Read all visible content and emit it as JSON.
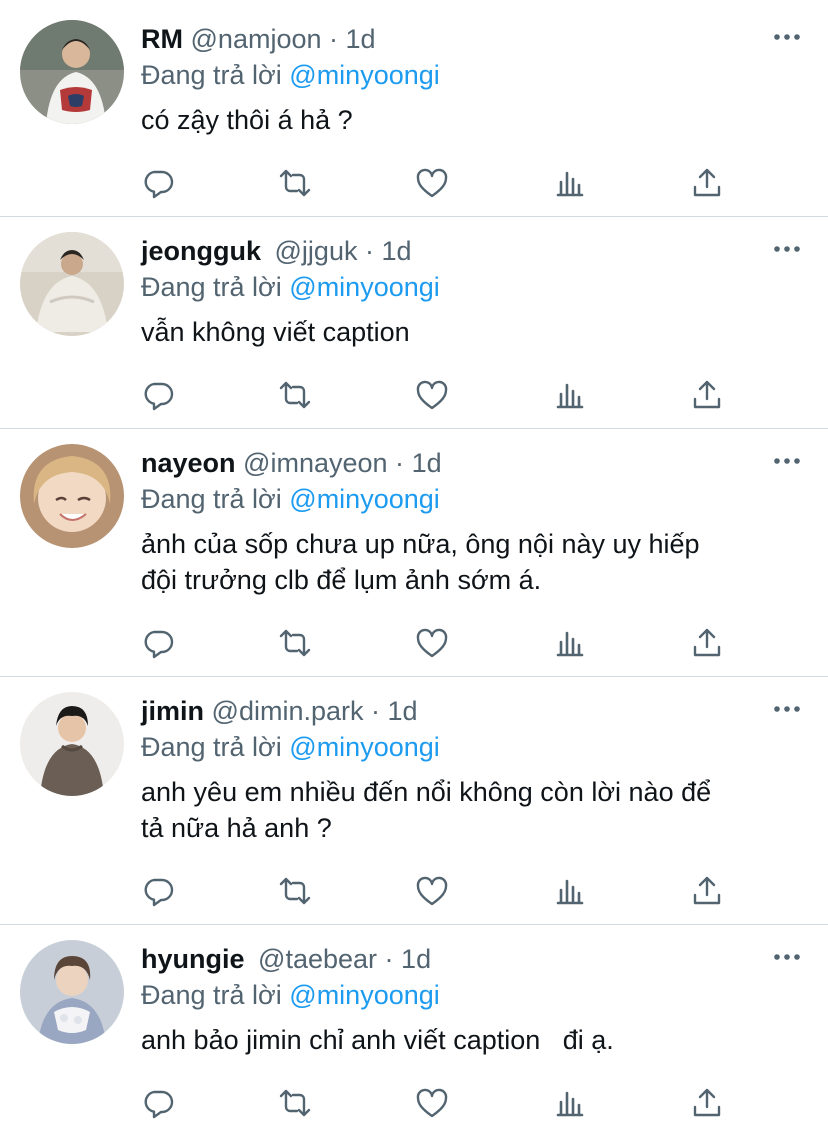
{
  "tweets": [
    {
      "name": "RM",
      "handle": "@namjoon",
      "sep": "·",
      "time": "1d",
      "reply_prefix": "Đang trả lời",
      "reply_to": "@minyoongi",
      "text": "có zậy thôi á hả ?",
      "avatar_bg": "#7c8a7a"
    },
    {
      "name": "jeongguk",
      "handle": "@jjguk",
      "sep": "·",
      "time": "1d",
      "reply_prefix": "Đang trả lời",
      "reply_to": "@minyoongi",
      "text": "vẫn không viết caption",
      "avatar_bg": "#d9d3c7"
    },
    {
      "name": "nayeon",
      "handle": "@imnayeon",
      "sep": "·",
      "time": "1d",
      "reply_prefix": "Đang trả lời",
      "reply_to": "@minyoongi",
      "text": "ảnh của sốp chưa up nữa, ông nội này uy hiếp\nđội trưởng clb để lụm ảnh sớm á.",
      "avatar_bg": "#c7a27d"
    },
    {
      "name": "jimin",
      "handle": "@dimin.park",
      "sep": "·",
      "time": "1d",
      "reply_prefix": "Đang trả lời",
      "reply_to": "@minyoongi",
      "text": "anh yêu em nhiều đến nổi không còn lời nào để\ntả nữa hả anh ?",
      "avatar_bg": "#efeeec"
    },
    {
      "name": "hyungie",
      "handle": "@taebear",
      "sep": "·",
      "time": "1d",
      "reply_prefix": "Đang trả lời",
      "reply_to": "@minyoongi",
      "text": "anh bảo jimin chỉ anh viết caption   đi ạ.",
      "avatar_bg": "#c9d0da"
    }
  ],
  "icons": {
    "more": "more-dots-icon",
    "reply": "reply-icon",
    "retweet": "retweet-icon",
    "like": "heart-icon",
    "views": "analytics-icon",
    "share": "share-icon"
  },
  "colors": {
    "mention": "#1d9bf0",
    "secondary_text": "#536471",
    "icon": "#536471",
    "divider": "#cfd9de"
  }
}
